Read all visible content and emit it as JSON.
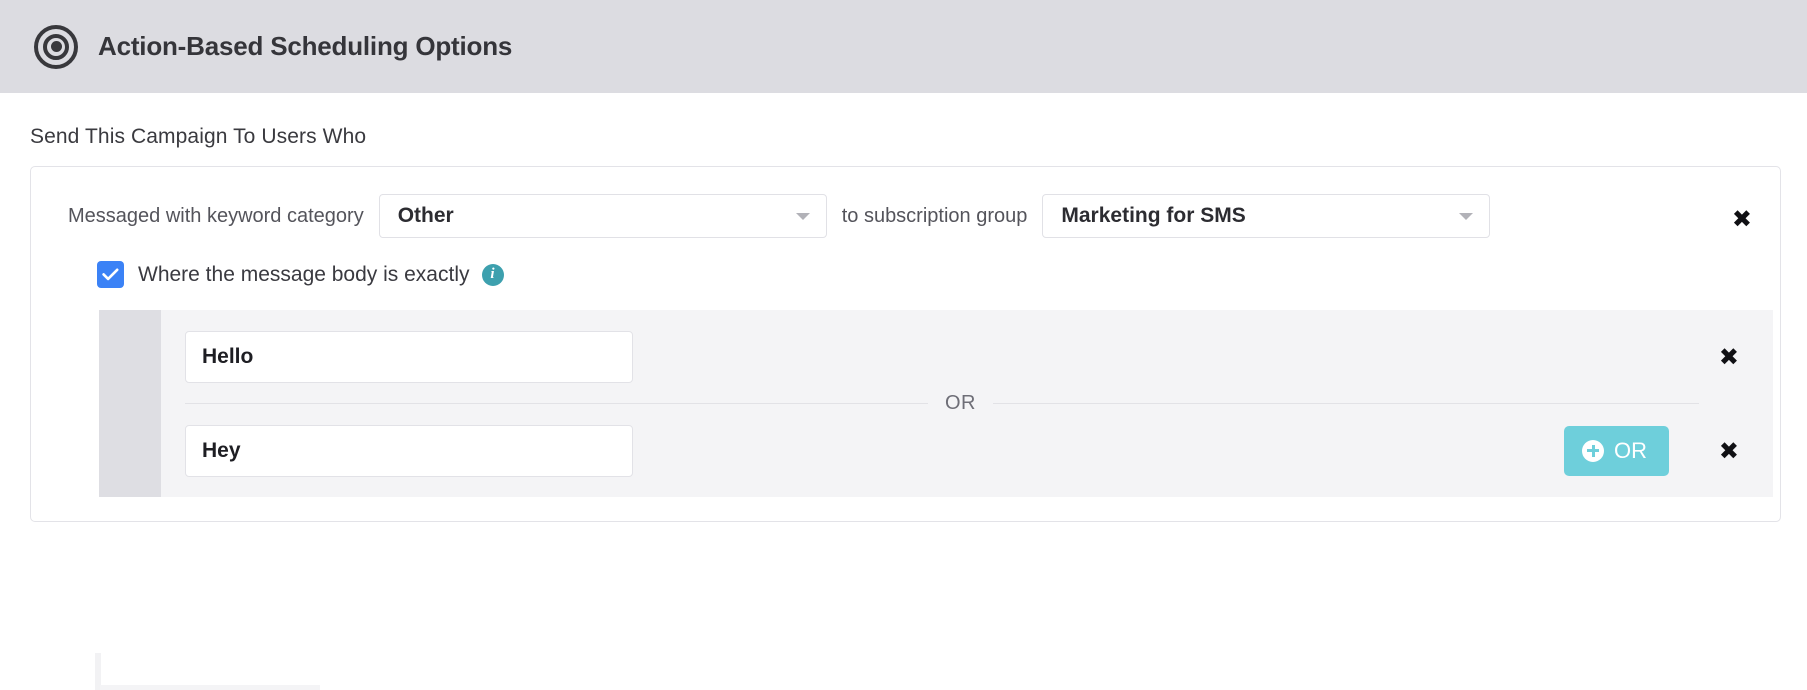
{
  "header": {
    "title": "Action-Based Scheduling Options",
    "icon": "bullseye-target-icon",
    "background_color": "#dcdce1"
  },
  "section": {
    "title": "Send This Campaign To Users Who"
  },
  "condition": {
    "prefix_label": "Messaged with keyword category",
    "keyword_category": {
      "value": "Other",
      "caret_icon": "chevron-down-icon"
    },
    "middle_label": "to subscription group",
    "subscription_group": {
      "value": "Marketing for SMS",
      "caret_icon": "chevron-down-icon"
    },
    "remove_icon": "close-x-icon"
  },
  "message_body": {
    "checkbox_checked": true,
    "checkbox_color": "#3b82f6",
    "label": "Where the message body is exactly",
    "info_icon": "info-circle-icon",
    "info_icon_color": "#3da0ae",
    "values": [
      {
        "value": "Hello",
        "remove_icon": "close-x-icon"
      },
      {
        "value": "Hey",
        "remove_icon": "close-x-icon"
      }
    ],
    "or_divider_label": "OR",
    "or_button": {
      "label": "OR",
      "plus_icon": "plus-circle-icon",
      "color": "#6ecfdb"
    }
  }
}
